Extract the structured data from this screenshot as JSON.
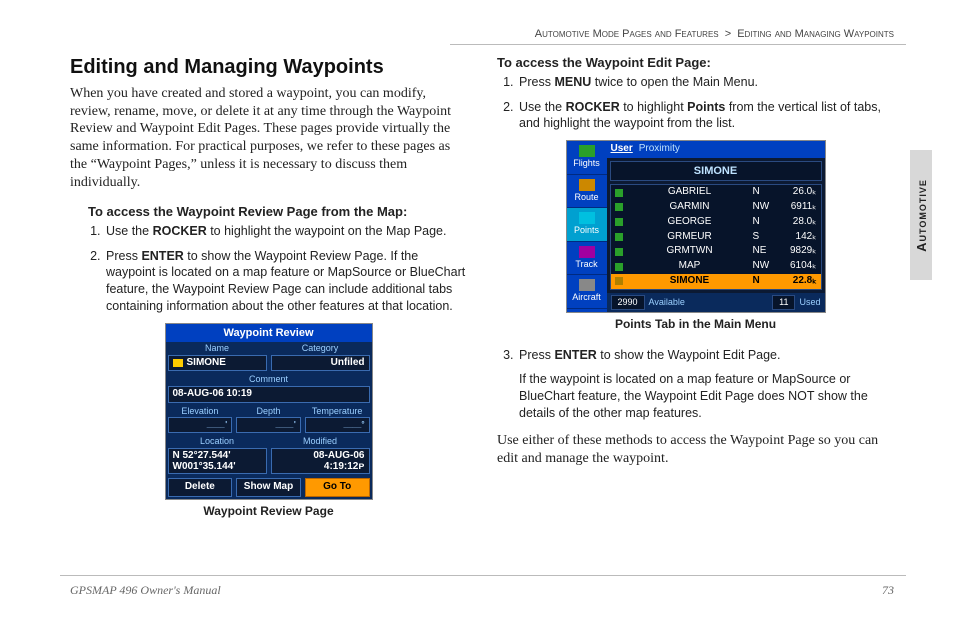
{
  "breadcrumb": {
    "a": "Automotive Mode Pages and Features",
    "b": "Editing and Managing Waypoints"
  },
  "sidetab": "Automotive",
  "left": {
    "title": "Editing and Managing Waypoints",
    "intro": "When you have created and stored a waypoint, you can modify, review, rename, move, or delete it at any time through the Waypoint Review and Waypoint Edit Pages. These pages provide virtually the same information. For practical purposes, we refer to these pages as the “Waypoint Pages,” unless it is necessary to discuss them individually.",
    "sub": "To access the Waypoint Review Page from the Map:",
    "steps": {
      "s1a": "Use the ",
      "s1b": "ROCKER",
      "s1c": " to highlight the waypoint on the Map Page.",
      "s2a": "Press ",
      "s2b": "ENTER",
      "s2c": " to show the Waypoint Review Page. If the waypoint is located on a map feature or MapSource or BlueChart feature, the Waypoint Review Page can include additional tabs containing information about the other features at that location."
    },
    "fig": {
      "title": "Waypoint Review",
      "name_lbl": "Name",
      "name_val": "SIMONE",
      "cat_lbl": "Category",
      "cat_val": "Unfiled",
      "comment_lbl": "Comment",
      "comment_val": "08-AUG-06 10:19",
      "elev_lbl": "Elevation",
      "depth_lbl": "Depth",
      "temp_lbl": "Temperature",
      "elev_val": "____ '",
      "depth_val": "____ '",
      "temp_val": "____°",
      "loc_lbl": "Location",
      "mod_lbl": "Modified",
      "loc1": "N  52°27.544'",
      "loc2": "W001°35.144'",
      "mod1": "08-AUG-06",
      "mod2": "4:19:12ᴘ",
      "btn_delete": "Delete",
      "btn_map": "Show Map",
      "btn_goto": "Go To",
      "caption": "Waypoint Review Page"
    }
  },
  "right": {
    "sub": "To access the Waypoint Edit Page:",
    "steps": {
      "s1a": "Press ",
      "s1b": "MENU",
      "s1c": " twice to open the Main Menu.",
      "s2a": "Use the ",
      "s2b": "ROCKER",
      "s2c": " to highlight ",
      "s2d": "Points",
      "s2e": " from the vertical list of tabs, and highlight the waypoint from the list."
    },
    "fig": {
      "side": [
        "Flights",
        "Route",
        "Points",
        "Track",
        "Aircraft"
      ],
      "sel_side": 2,
      "tab_user": "User",
      "tab_prox": "Proximity",
      "name": "SIMONE",
      "rows": [
        {
          "n": "GABRIEL",
          "d": "N",
          "v": "26.0ₖ"
        },
        {
          "n": "GARMIN",
          "d": "NW",
          "v": "6911ₖ"
        },
        {
          "n": "GEORGE",
          "d": "N",
          "v": "28.0ₖ"
        },
        {
          "n": "GRMEUR",
          "d": "S",
          "v": "142ₖ"
        },
        {
          "n": "GRMTWN",
          "d": "NE",
          "v": "9829ₖ"
        },
        {
          "n": "MAP",
          "d": "NW",
          "v": "6104ₖ"
        },
        {
          "n": "SIMONE",
          "d": "N",
          "v": "22.8ₖ"
        }
      ],
      "sel_row": 6,
      "foot_a": "2990",
      "foot_a_lbl": "Available",
      "foot_b": "11",
      "foot_b_lbl": "Used",
      "caption": "Points Tab in the Main Menu"
    },
    "step3": {
      "a": "Press ",
      "b": "ENTER",
      "c": " to show the Waypoint Edit Page.",
      "note": "If the waypoint is located on a map feature or MapSource or BlueChart feature, the Waypoint Edit Page does NOT show the details of the other map features."
    },
    "closing": "Use either of these methods to access the Waypoint Page so you can edit and manage the waypoint."
  },
  "footer": {
    "left": "GPSMAP 496 Owner's Manual",
    "right": "73"
  }
}
